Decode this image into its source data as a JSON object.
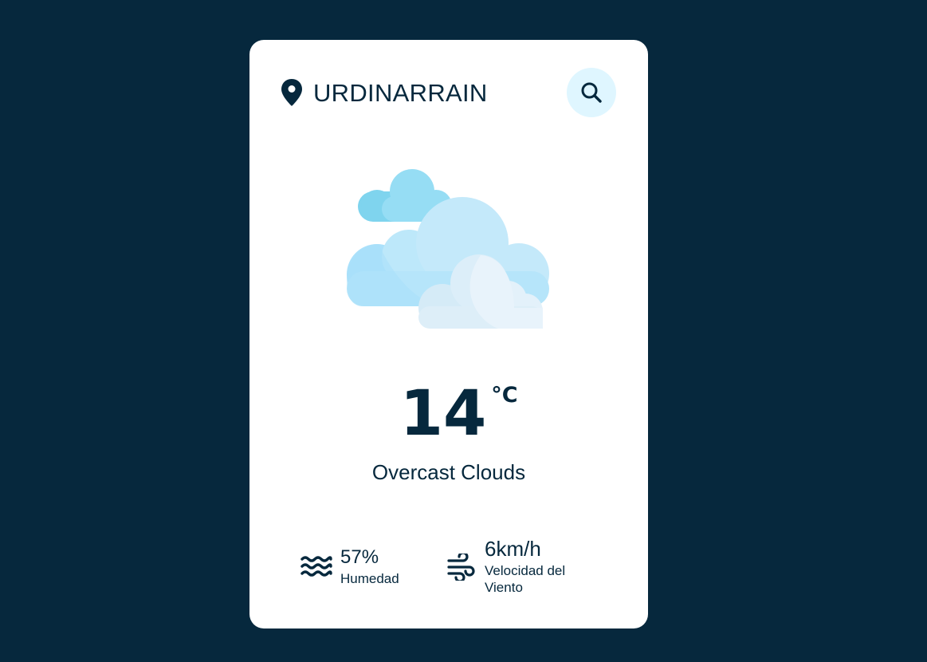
{
  "location": {
    "city": "URDINARRAIN",
    "pin_icon": "location-pin-icon"
  },
  "search": {
    "icon": "search-icon"
  },
  "weather": {
    "icon": "overcast-clouds-icon",
    "temperature": "14",
    "unit": "°C",
    "description": "Overcast Clouds"
  },
  "details": {
    "humidity": {
      "icon": "humidity-waves-icon",
      "value": "57%",
      "label": "Humedad"
    },
    "wind": {
      "icon": "wind-icon",
      "value": "6km/h",
      "label": "Velocidad del Viento"
    }
  },
  "colors": {
    "background": "#06283d",
    "card": "#ffffff",
    "text": "#06283d",
    "search_button_bg": "#dff6ff"
  }
}
